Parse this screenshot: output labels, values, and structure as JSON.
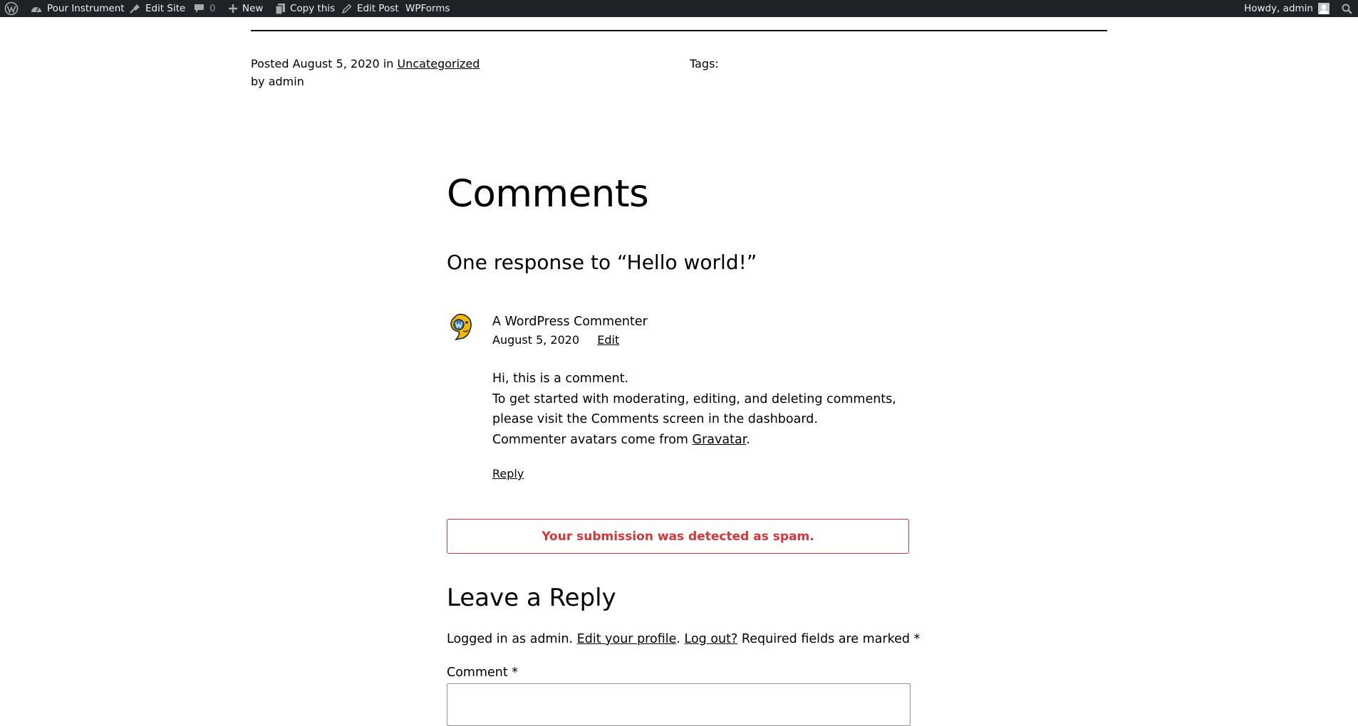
{
  "colors": {
    "admin_bar_bg": "#1d2327",
    "admin_bar_text": "#f0f0f1",
    "spam_notice": "#d63638"
  },
  "admin_bar": {
    "site_name": "Pour Instrument",
    "edit_site": "Edit Site",
    "comments_count": "0",
    "new": "New",
    "copy_this": "Copy this",
    "edit_post": "Edit Post",
    "wpforms": "WPForms",
    "howdy": "Howdy, admin"
  },
  "post_meta": {
    "posted_label": "Posted",
    "date": "August 5, 2020",
    "in_label": "in",
    "category": "Uncategorized",
    "byline": "by admin",
    "tags_label": "Tags:"
  },
  "comments": {
    "title": "Comments",
    "responses_title": "One response to “Hello world!”",
    "items": [
      {
        "author": "A WordPress Commenter",
        "date": "August 5, 2020",
        "edit_label": "Edit",
        "line1": "Hi, this is a comment.",
        "line2": "To get started with moderating, editing, and deleting comments, please visit the Comments screen in the dashboard.",
        "line3_prefix": "Commenter avatars come from",
        "line3_link": "Gravatar",
        "line3_suffix": ".",
        "reply_label": "Reply"
      }
    ]
  },
  "spam_notice": "Your submission was detected as spam.",
  "reply_form": {
    "title": "Leave a Reply",
    "logged_in_prefix": "Logged in as admin.",
    "edit_profile": "Edit your profile",
    "period": ".",
    "log_out": "Log out?",
    "required_text": "Required fields are marked *",
    "comment_label": "Comment *",
    "comment_value": ""
  }
}
